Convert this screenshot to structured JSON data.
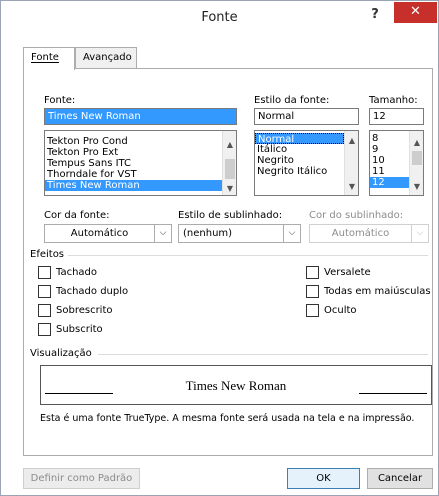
{
  "dialog": {
    "title": "Fonte",
    "help_label": "?",
    "close_label": "✕"
  },
  "tabs": [
    {
      "label": "Fonte",
      "active": true
    },
    {
      "label": "Avançado",
      "active": false
    }
  ],
  "font": {
    "label": "Fonte:",
    "value": "Times New Roman",
    "items": [
      "Tekton Pro Cond",
      "Tekton Pro Ext",
      "Tempus Sans ITC",
      "Thorndale for VST",
      "Times New Roman"
    ],
    "selected": "Times New Roman"
  },
  "style": {
    "label": "Estilo da fonte:",
    "value": "Normal",
    "items": [
      "Normal",
      "Itálico",
      "Negrito",
      "Negrito Itálico"
    ],
    "selected": "Normal"
  },
  "size": {
    "label": "Tamanho:",
    "value": "12",
    "items": [
      "8",
      "9",
      "10",
      "11",
      "12"
    ],
    "selected": "12"
  },
  "color": {
    "label": "Cor da fonte:",
    "value": "Automático"
  },
  "underline_style": {
    "label": "Estilo de sublinhado:",
    "value": "(nenhum)"
  },
  "underline_color": {
    "label": "Cor do sublinhado:",
    "value": "Automático"
  },
  "effects": {
    "label": "Efeitos",
    "left": [
      "Tachado",
      "Tachado duplo",
      "Sobrescrito",
      "Subscrito"
    ],
    "right": [
      "Versalete",
      "Todas em maiúsculas",
      "Oculto"
    ]
  },
  "preview": {
    "label": "Visualização",
    "sample": "Times New Roman",
    "description": "Esta é uma fonte TrueType. A mesma fonte será usada na tela e na impressão."
  },
  "buttons": {
    "set_default": "Definir como Padrão",
    "ok": "OK",
    "cancel": "Cancelar"
  },
  "colors": {
    "selection": "#3399ff",
    "close": "#c7302a"
  }
}
